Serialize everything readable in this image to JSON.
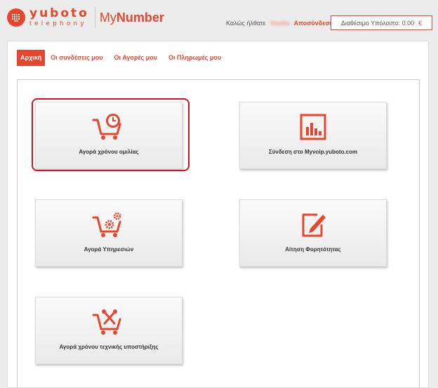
{
  "header": {
    "logo_word": "yuboto",
    "logo_sub": "telephony",
    "product_prefix": "My",
    "product_suffix": "Number",
    "welcome_label": "Καλώς ήλθατε",
    "username": "Vasilis",
    "logout_label": "Αποσύνδεση",
    "balance_label": "Διαθέσιμο Υπόλοιπο: 0.00",
    "currency": "€"
  },
  "nav": {
    "items": [
      {
        "label": "Αρχική",
        "active": true
      },
      {
        "label": "Οι συνδέσεις μου"
      },
      {
        "label": "Οι Αγορές μου"
      },
      {
        "label": "Οι Πληρωμές μου"
      }
    ]
  },
  "tiles": [
    {
      "label": "Αγορά χρόνου ομιλίας",
      "icon": "cart-clock-icon",
      "highlighted": true
    },
    {
      "label": "Σύνδεση στο Myvoip.yuboto.com",
      "icon": "bar-chart-icon"
    },
    {
      "label": "Αγορά Υπηρεσιών",
      "icon": "cart-gears-icon"
    },
    {
      "label": "Αίτηση Φορητότητας",
      "icon": "edit-document-icon"
    },
    {
      "label": "Αγορά χρόνου τεχνικής υποστήριξης",
      "icon": "cart-tools-icon"
    }
  ],
  "colors": {
    "accent": "#e8452c",
    "highlight": "#d6121e"
  }
}
